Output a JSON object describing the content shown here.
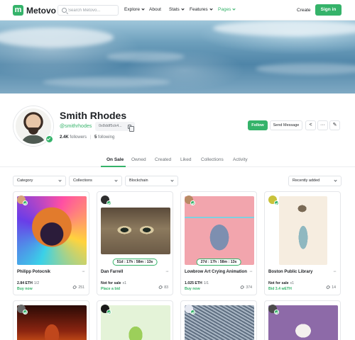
{
  "header": {
    "brand_mark": "m",
    "brand": "Metovo",
    "search_placeholder": "Search Metovo...",
    "nav": [
      {
        "label": "Explore",
        "dropdown": true
      },
      {
        "label": "About",
        "dropdown": false
      },
      {
        "label": "Stats",
        "dropdown": true
      },
      {
        "label": "Features",
        "dropdown": true
      },
      {
        "label": "Pages",
        "dropdown": true,
        "active": true
      }
    ],
    "create": "Create",
    "sign_in": "Sign in"
  },
  "profile": {
    "name": "Smith Rhodes",
    "handle": "@smithrhodes",
    "address": "0x8ddf5ck4...",
    "followers_count": "2.4K",
    "followers_label": "followers",
    "following_count": "5",
    "following_label": "following",
    "follow_button": "Follow",
    "message_button": "Send Message"
  },
  "tabs": [
    "On Sale",
    "Owned",
    "Created",
    "Liked",
    "Collections",
    "Activity"
  ],
  "filters": {
    "category": "Category",
    "collections": "Collections",
    "blockchain": "Blockchain",
    "sort": "Recently added"
  },
  "cards": [
    {
      "title": "Philipp Potocnik",
      "price": "2.84 ETH",
      "edition": "1/2",
      "action": "Buy now",
      "likes": "251",
      "timer": ""
    },
    {
      "title": "Dan Farrell",
      "price": "Not for sale",
      "edition": "x1",
      "action": "Place a bid",
      "likes": "83",
      "timer": "51d : 17h : 58m : 13s"
    },
    {
      "title": "Lowbrow Art Crying Animation",
      "price": "1.025 ETH",
      "edition": "1/1",
      "action": "Buy now",
      "likes": "374",
      "timer": "27d : 17h : 58m : 13s"
    },
    {
      "title": "Boston Public Library",
      "price": "Not for sale",
      "edition": "x1",
      "action": "Bid 3.4 wETH",
      "likes": "14",
      "timer": ""
    }
  ],
  "colors": {
    "accent": "#35b36a",
    "text": "#1e2125",
    "muted": "#6c7176"
  }
}
